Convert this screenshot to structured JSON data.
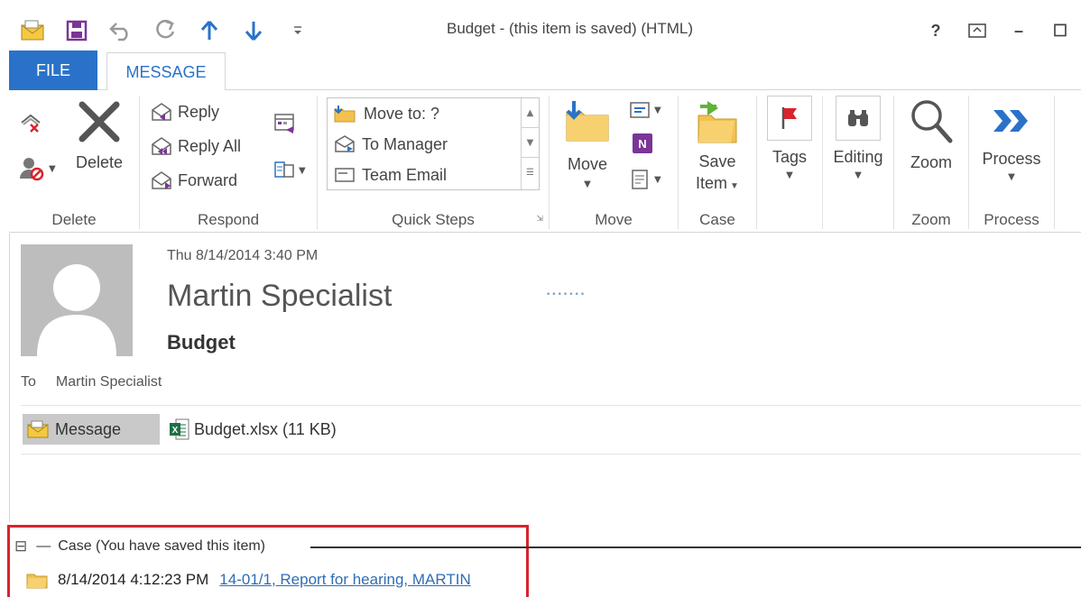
{
  "window": {
    "title": "Budget - (this item is saved) (HTML)",
    "help": "?",
    "restore_glyph": "⧉",
    "minimize_glyph": "–",
    "maximize_glyph": "☐"
  },
  "qat": {
    "items": [
      "envelope-icon",
      "save-icon",
      "undo-icon",
      "redo-icon",
      "up-arrow-icon",
      "down-arrow-icon",
      "customize-icon"
    ]
  },
  "tabs": {
    "file": "FILE",
    "message": "MESSAGE"
  },
  "ribbon": {
    "delete_group": {
      "label": "Delete",
      "delete_button": "Delete"
    },
    "respond_group": {
      "label": "Respond",
      "reply": "Reply",
      "reply_all": "Reply All",
      "forward": "Forward"
    },
    "quick_steps_group": {
      "label": "Quick Steps",
      "items": [
        "Move to: ?",
        "To Manager",
        "Team Email"
      ]
    },
    "move_group": {
      "label": "Move",
      "move_button": "Move"
    },
    "case_group": {
      "label": "Case",
      "save_line1": "Save",
      "save_line2": "Item"
    },
    "tags_group": {
      "tags_button": "Tags"
    },
    "editing_group": {
      "editing_button": "Editing"
    },
    "zoom_group": {
      "label": "Zoom",
      "zoom_button": "Zoom"
    },
    "process_group": {
      "label": "Process",
      "process_button": "Process"
    },
    "colors": {
      "accent": "#2a72c9",
      "flag": "#d9232d",
      "folder": "#f2c14e"
    }
  },
  "message": {
    "date": "Thu 8/14/2014 3:40 PM",
    "sender": "Martin Specialist",
    "subject": "Budget",
    "to_label": "To",
    "to_value": "Martin Specialist",
    "attachments": {
      "message_tab": "Message",
      "file": "Budget.xlsx (11 KB)"
    }
  },
  "case_panel": {
    "header": "Case (You have saved this item)",
    "collapse_glyph": "⊟",
    "timestamp": "8/14/2014 4:12:23 PM",
    "link": "14-01/1, Report for hearing, MARTIN",
    "highlight_color": "#d9232d"
  }
}
